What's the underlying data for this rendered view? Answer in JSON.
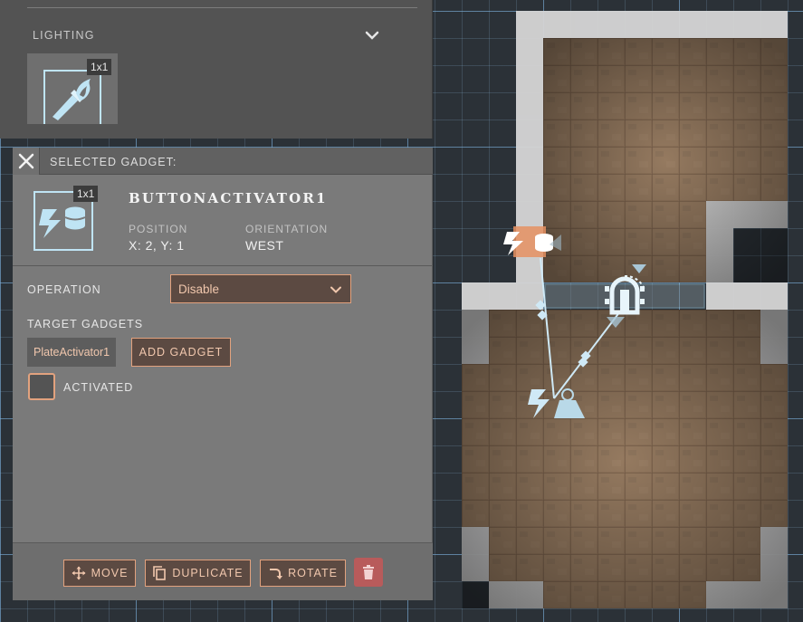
{
  "lighting": {
    "section_label": "LIGHTING",
    "tile": {
      "size_badge": "1x1",
      "icon": "torch-icon"
    }
  },
  "selected_gadget": {
    "header_title": "SELECTED GADGET:",
    "size_badge": "1x1",
    "name": "BUTTONACTIVATOR1",
    "position_label": "POSITION",
    "position_value": "X: 2, Y: 1",
    "orientation_label": "ORIENTATION",
    "orientation_value": "WEST",
    "operation_label": "OPERATION",
    "operation_value": "Disable",
    "target_gadgets_label": "TARGET GADGETS",
    "target_chip": "PlateActivator1",
    "add_gadget_label": "ADD GADGET",
    "activated_label": "ACTIVATED",
    "activated": false
  },
  "footer": {
    "move_label": "MOVE",
    "duplicate_label": "DUPLICATE",
    "rotate_label": "ROTATE"
  },
  "colors": {
    "accent": "#e2a27e",
    "accent_text": "#f1c7ad",
    "button_bg": "#5c4a42",
    "gadget_icon": "#bfe4f4",
    "delete": "#b85b5b",
    "floor": "#8a7058",
    "wall": "#d6d6d6",
    "grid": "#78afe1"
  }
}
